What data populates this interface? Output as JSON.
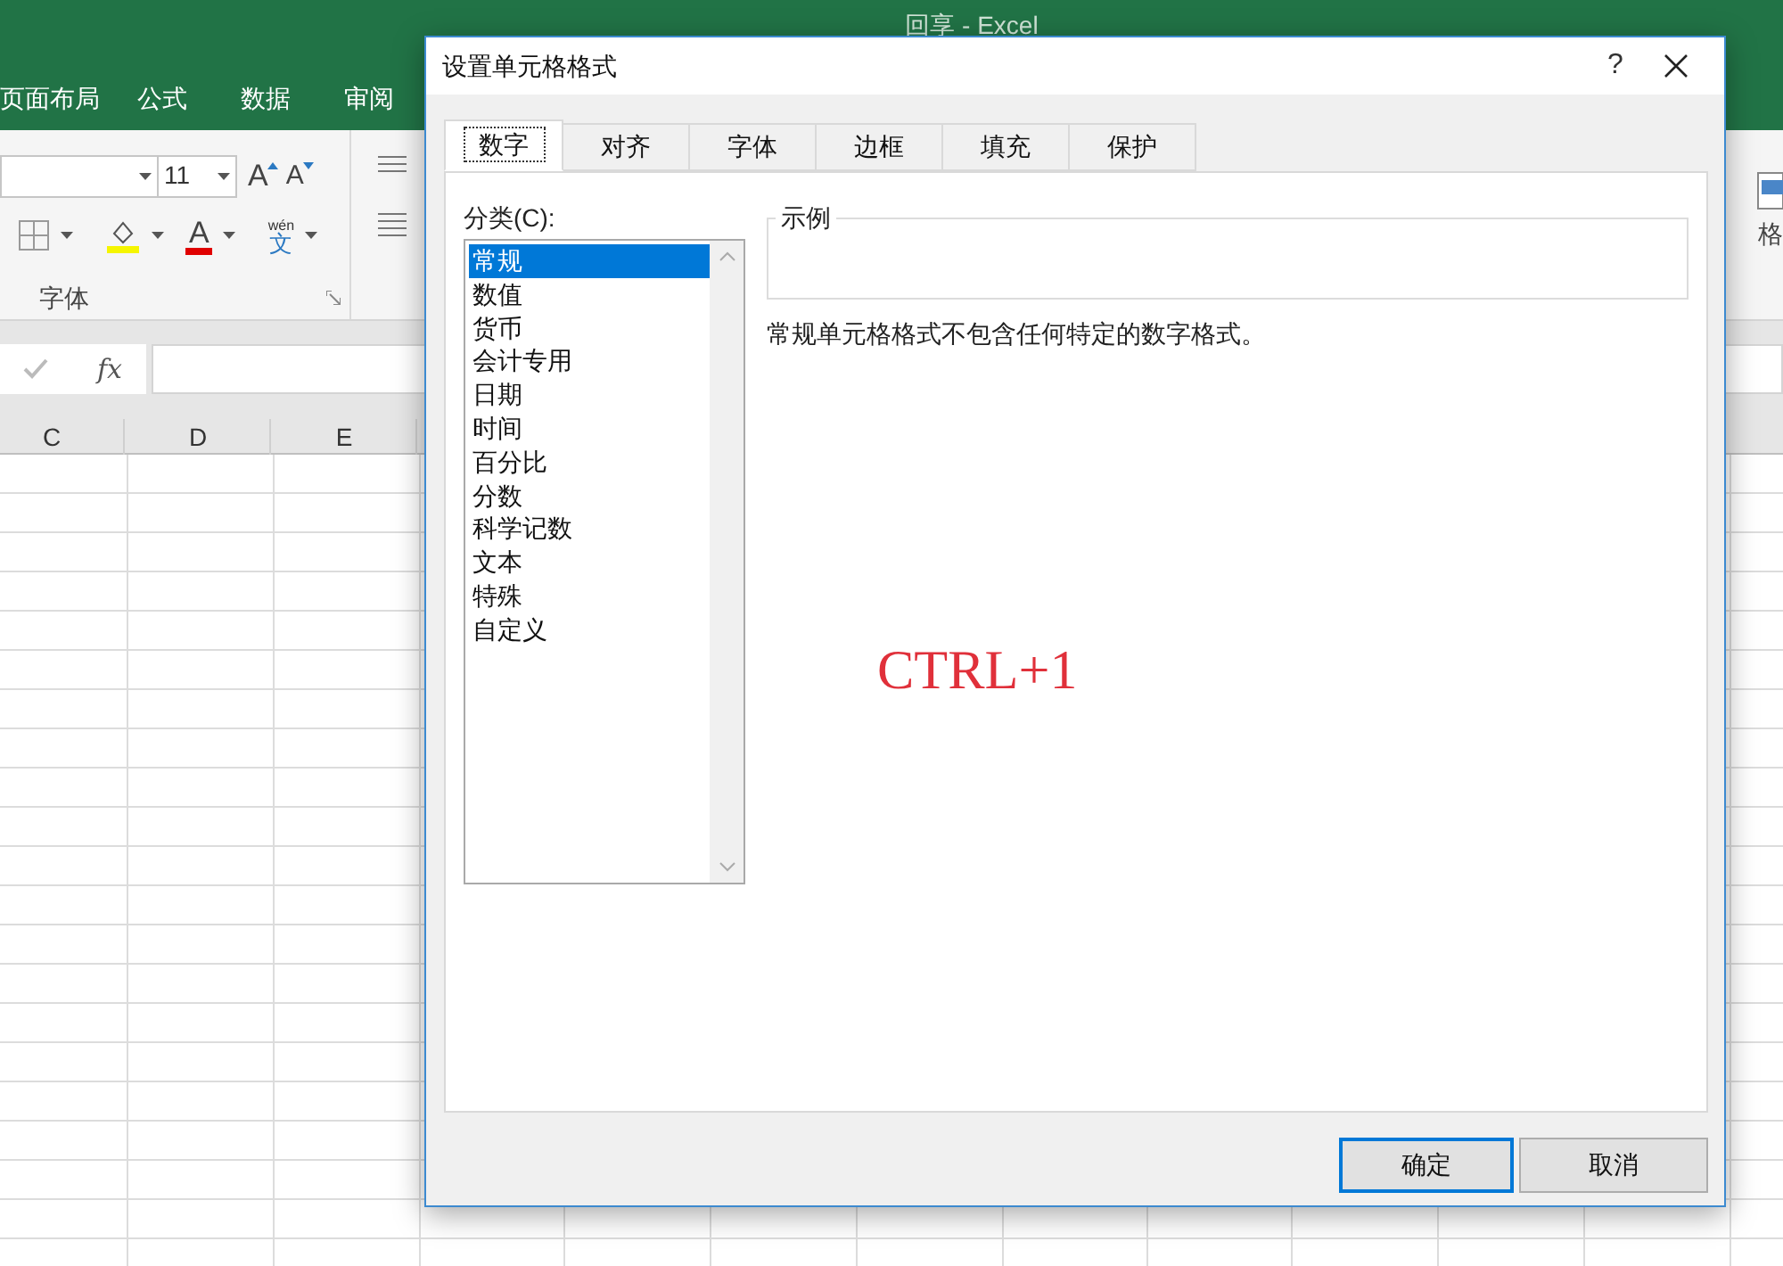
{
  "app": {
    "title": "回享 - Excel",
    "ribbon_tabs": [
      "页面布局",
      "公式",
      "数据",
      "审阅"
    ],
    "font_size": "11",
    "grow_font": "A",
    "shrink_font": "A",
    "font_color": "A",
    "phonetic_top": "wén",
    "phonetic_bottom": "文",
    "font_group_label": "字体",
    "right_button_label": "格",
    "fx": "fx",
    "columns": [
      "C",
      "D",
      "E"
    ]
  },
  "dialog": {
    "title": "设置单元格格式",
    "help": "?",
    "tabs": [
      {
        "label": "数字",
        "selected": true
      },
      {
        "label": "对齐",
        "selected": false
      },
      {
        "label": "字体",
        "selected": false
      },
      {
        "label": "边框",
        "selected": false
      },
      {
        "label": "填充",
        "selected": false
      },
      {
        "label": "保护",
        "selected": false
      }
    ],
    "category_label": "分类(C):",
    "categories": [
      {
        "label": "常规",
        "selected": true
      },
      {
        "label": "数值",
        "selected": false
      },
      {
        "label": "货币",
        "selected": false
      },
      {
        "label": "会计专用",
        "selected": false
      },
      {
        "label": "日期",
        "selected": false
      },
      {
        "label": "时间",
        "selected": false
      },
      {
        "label": "百分比",
        "selected": false
      },
      {
        "label": "分数",
        "selected": false
      },
      {
        "label": "科学记数",
        "selected": false
      },
      {
        "label": "文本",
        "selected": false
      },
      {
        "label": "特殊",
        "selected": false
      },
      {
        "label": "自定义",
        "selected": false
      }
    ],
    "sample_label": "示例",
    "description": "常规单元格格式不包含任何特定的数字格式。",
    "buttons": [
      {
        "label": "确定",
        "default": true
      },
      {
        "label": "取消",
        "default": false
      }
    ]
  },
  "annotation": "CTRL+1"
}
